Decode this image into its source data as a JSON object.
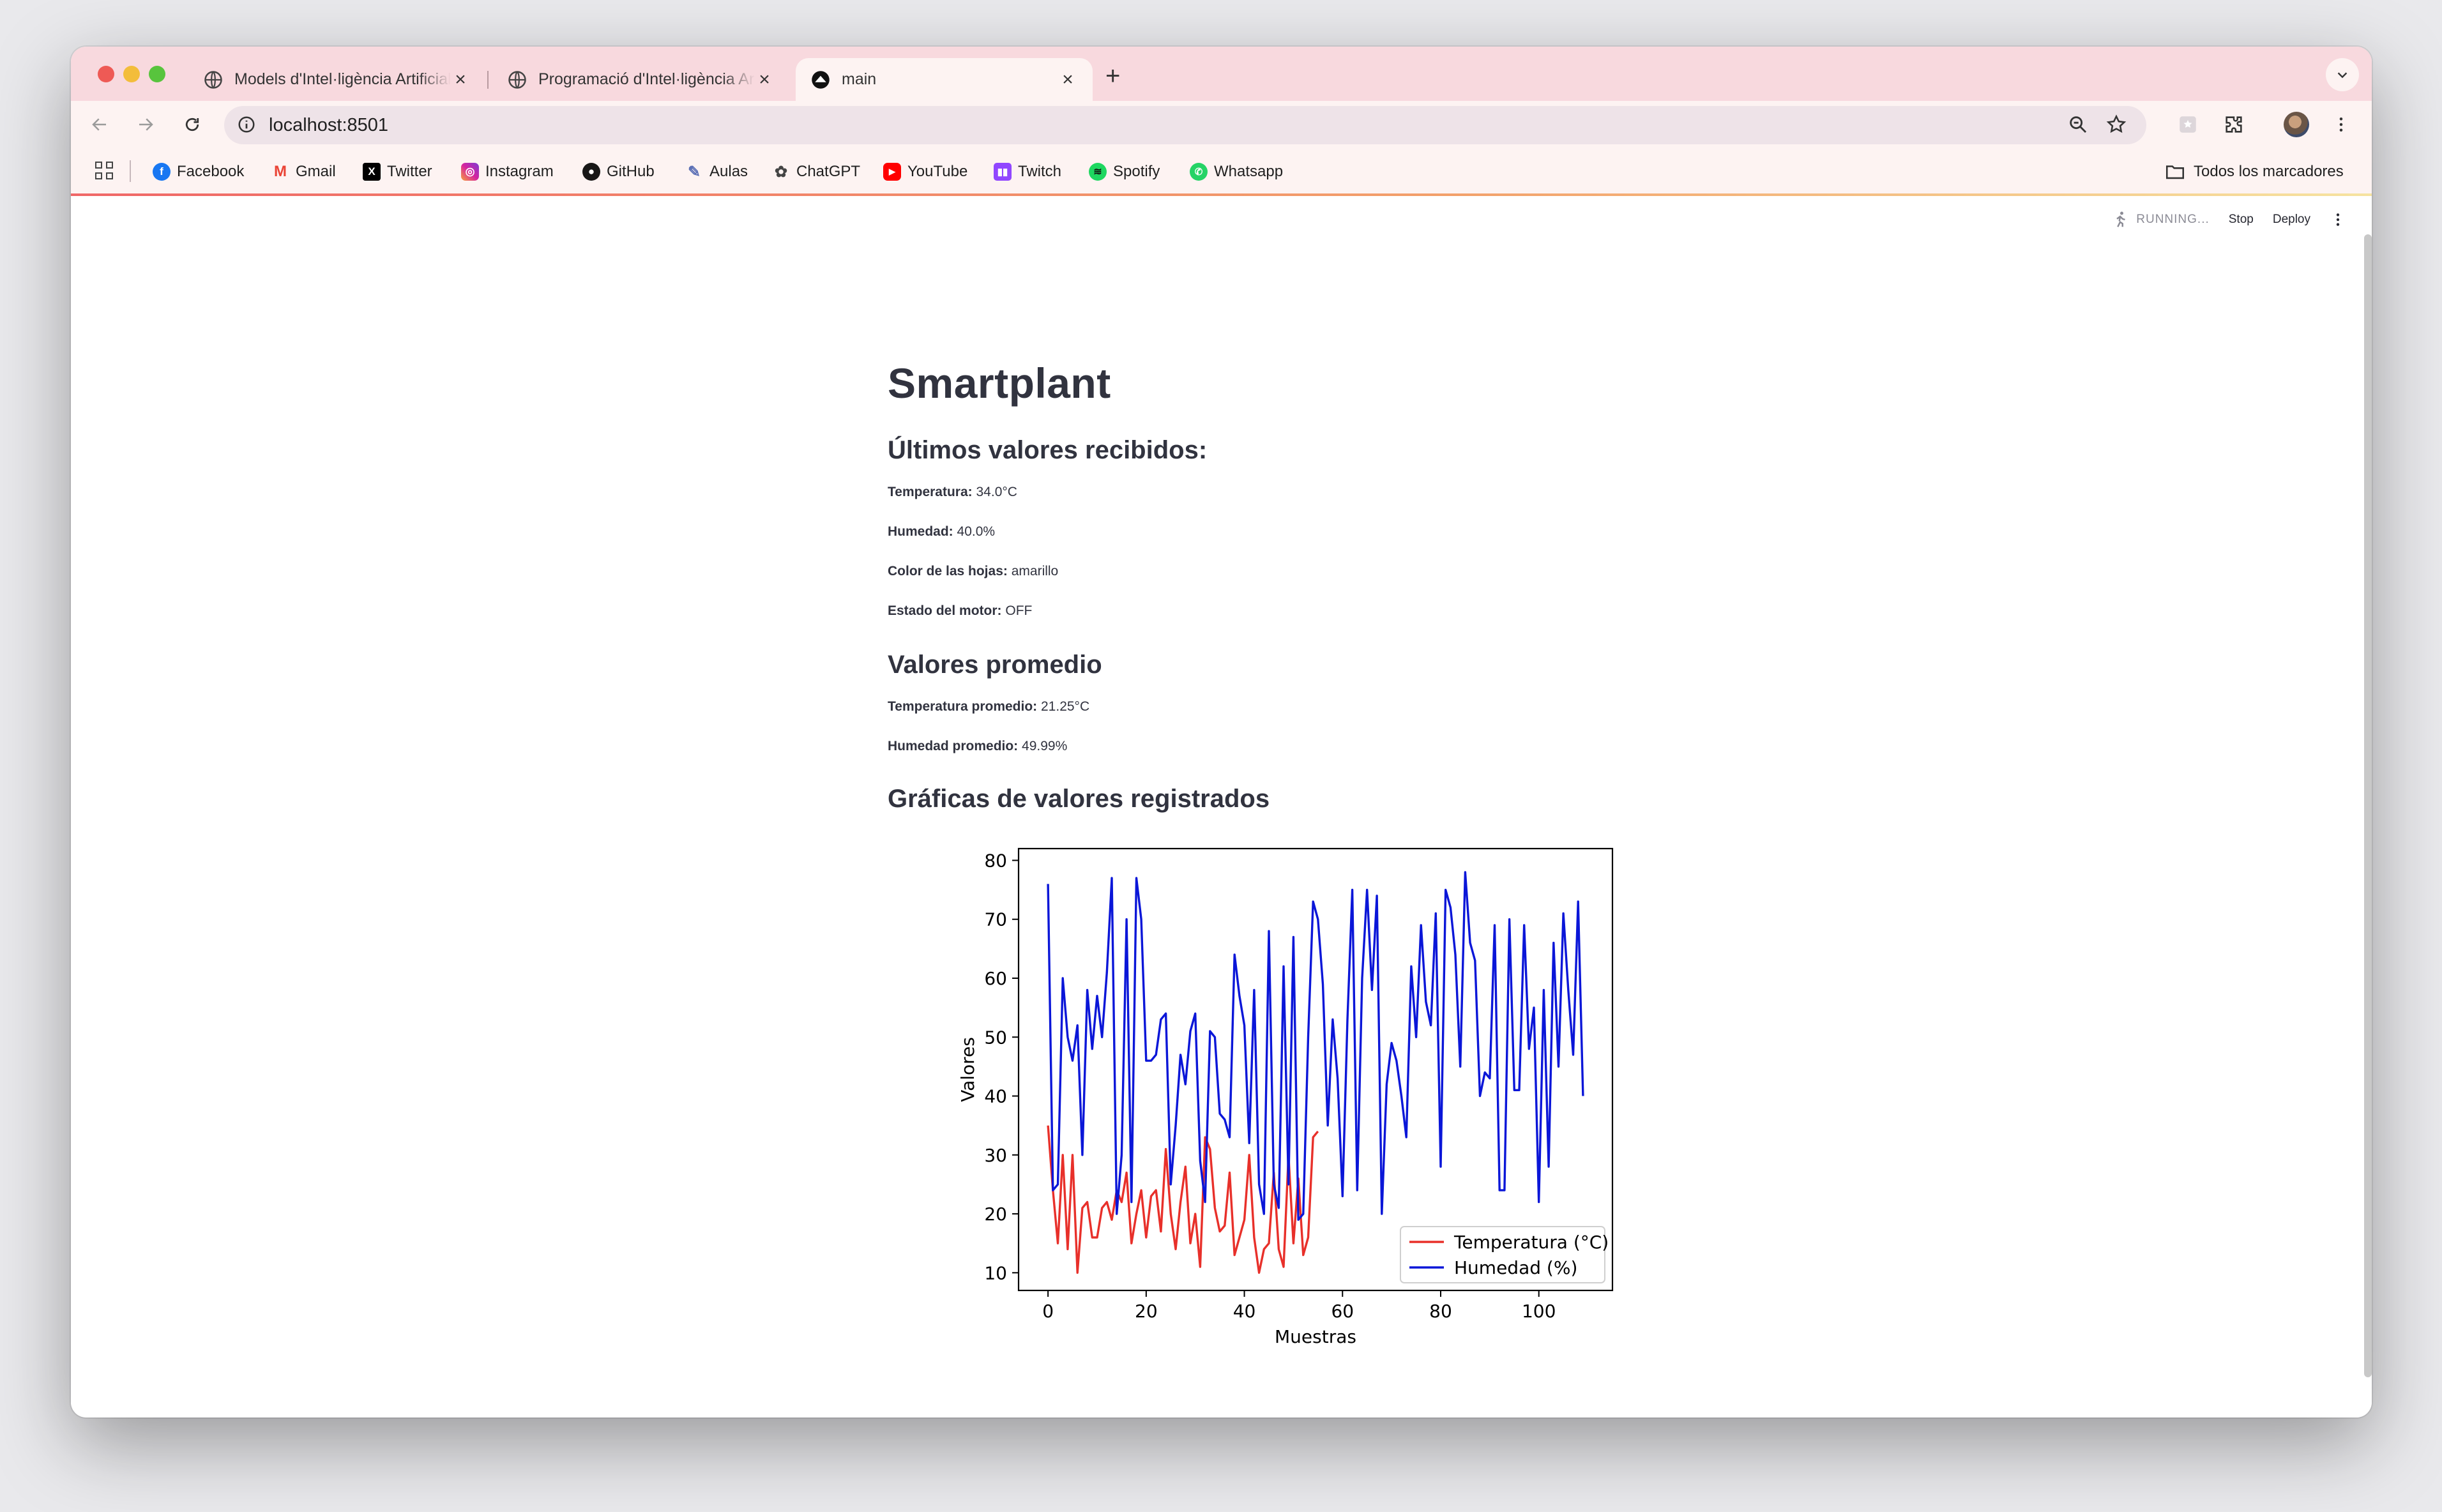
{
  "browser": {
    "tabs": [
      {
        "title": "Models d'Intel·ligència Artificial",
        "active": false
      },
      {
        "title": "Programació d'Intel·ligència Artificial",
        "active": false
      },
      {
        "title": "main",
        "active": true
      }
    ],
    "url": "localhost:8501",
    "bookmarks": [
      {
        "label": "Facebook",
        "icon": "facebook-icon",
        "color": "#1877f2"
      },
      {
        "label": "Gmail",
        "icon": "gmail-icon",
        "color": "#ea4335"
      },
      {
        "label": "Twitter",
        "icon": "x-icon",
        "color": "#000000"
      },
      {
        "label": "Instagram",
        "icon": "instagram-icon",
        "color": "#d6249f"
      },
      {
        "label": "GitHub",
        "icon": "github-icon",
        "color": "#181717"
      },
      {
        "label": "Aulas",
        "icon": "aulas-icon",
        "color": "#5b6fb5"
      },
      {
        "label": "ChatGPT",
        "icon": "chatgpt-icon",
        "color": "#444444"
      },
      {
        "label": "YouTube",
        "icon": "youtube-icon",
        "color": "#ff0000"
      },
      {
        "label": "Twitch",
        "icon": "twitch-icon",
        "color": "#9146ff"
      },
      {
        "label": "Spotify",
        "icon": "spotify-icon",
        "color": "#1ed760"
      },
      {
        "label": "Whatsapp",
        "icon": "whatsapp-icon",
        "color": "#25d366"
      }
    ],
    "all_bookmarks": "Todos los marcadores"
  },
  "streamlit": {
    "status": "RUNNING...",
    "stop": "Stop",
    "deploy": "Deploy"
  },
  "app": {
    "title": "Smartplant",
    "latest_heading": "Últimos valores recibidos:",
    "temp_label": "Temperatura:",
    "temp_value": "34.0°C",
    "hum_label": "Humedad:",
    "hum_value": "40.0%",
    "color_label": "Color de las hojas:",
    "color_value": "amarillo",
    "motor_label": "Estado del motor:",
    "motor_value": "OFF",
    "avg_heading": "Valores promedio",
    "avg_temp_label": "Temperatura promedio:",
    "avg_temp_value": "21.25°C",
    "avg_hum_label": "Humedad promedio:",
    "avg_hum_value": "49.99%",
    "charts_heading": "Gráficas de valores registrados"
  },
  "chart_data": {
    "type": "line",
    "xlabel": "Muestras",
    "ylabel": "Valores",
    "xlim": [
      -6,
      115
    ],
    "ylim": [
      7,
      82
    ],
    "xticks": [
      0,
      20,
      40,
      60,
      80,
      100
    ],
    "yticks": [
      10,
      20,
      30,
      40,
      50,
      60,
      70,
      80
    ],
    "legend_position": "lower-right",
    "series": [
      {
        "name": "Temperatura (°C)",
        "color": "#e8302a",
        "values": [
          35,
          24,
          15,
          30,
          14,
          30,
          10,
          21,
          22,
          16,
          16,
          21,
          22,
          19,
          24,
          22,
          27,
          15,
          20,
          24,
          16,
          23,
          24,
          17,
          31,
          20,
          14,
          22,
          28,
          15,
          20,
          11,
          33,
          31,
          21,
          17,
          18,
          27,
          13,
          16,
          19,
          30,
          16,
          10,
          14,
          15,
          27,
          14,
          11,
          30,
          15,
          26,
          13,
          16,
          33,
          34
        ]
      },
      {
        "name": "Humedad (%)",
        "color": "#0a16d8",
        "values": [
          76,
          24,
          25,
          60,
          50,
          46,
          52,
          30,
          58,
          48,
          57,
          50,
          61,
          77,
          20,
          30,
          70,
          22,
          77,
          70,
          46,
          46,
          47,
          53,
          54,
          25,
          35,
          47,
          42,
          51,
          54,
          29,
          22,
          51,
          50,
          37,
          36,
          33,
          64,
          57,
          52,
          32,
          58,
          25,
          20,
          68,
          25,
          21,
          62,
          25,
          67,
          19,
          20,
          50,
          73,
          70,
          59,
          35,
          53,
          43,
          23,
          53,
          75,
          24,
          60,
          75,
          58,
          74,
          20,
          42,
          49,
          46,
          40,
          33,
          62,
          50,
          69,
          56,
          52,
          71,
          28,
          75,
          72,
          64,
          45,
          78,
          66,
          63,
          40,
          44,
          43,
          69,
          24,
          24,
          70,
          41,
          41,
          69,
          48,
          55,
          22,
          58,
          28,
          66,
          45,
          71,
          58,
          47,
          73,
          40
        ]
      }
    ]
  }
}
